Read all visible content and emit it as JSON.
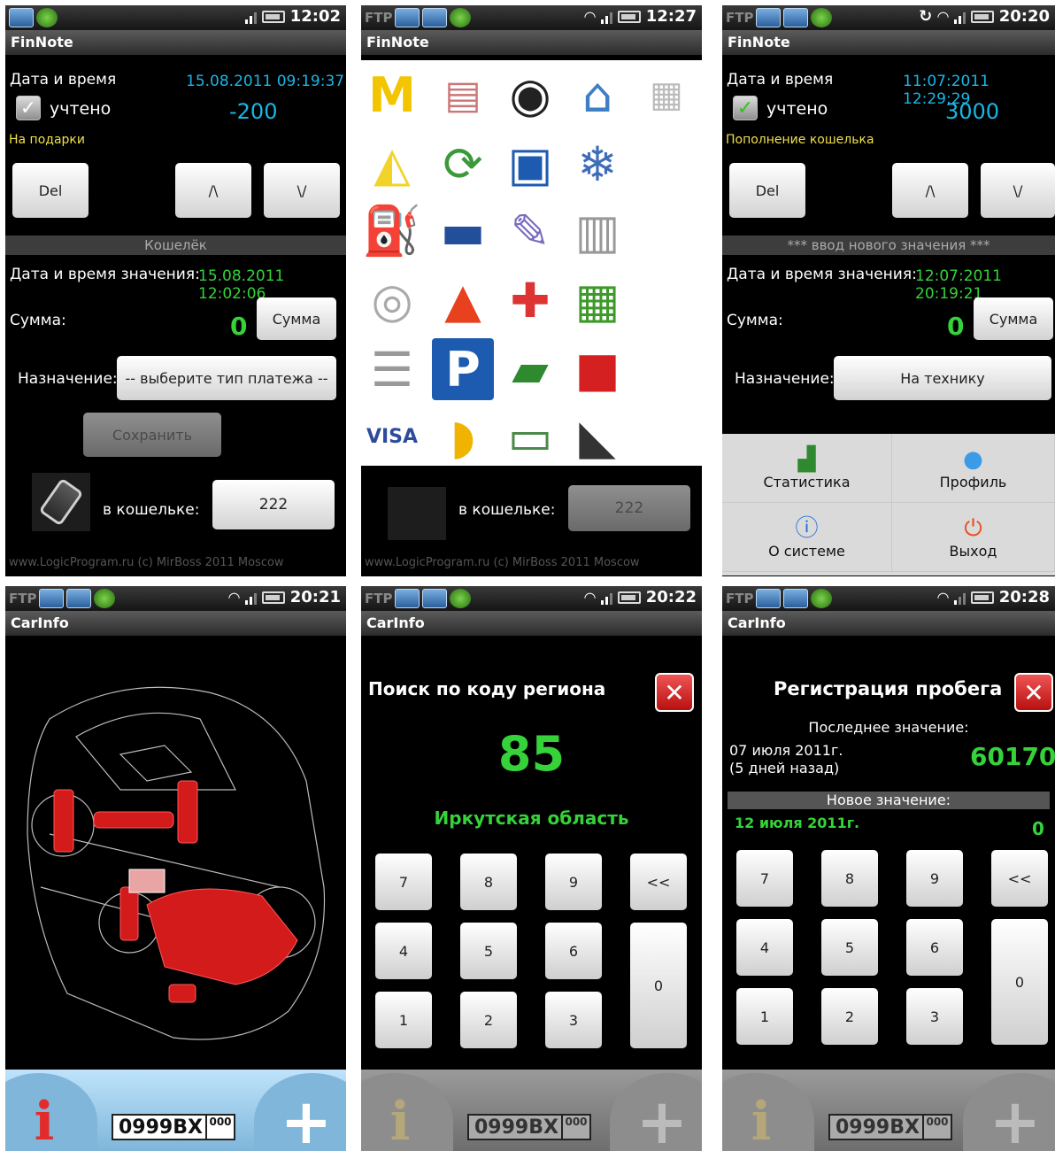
{
  "screens": {
    "s1": {
      "time": "12:02",
      "app_title": "FinNote",
      "datetime_label": "Дата и время",
      "datetime_value": "15.08.2011 09:19:37",
      "accounted_label": "учтено",
      "amount": "-200",
      "note": "На подарки",
      "del_label": "Del",
      "up_label": "/\\",
      "down_label": "\\/",
      "section_title": "Кошелёк",
      "value_datetime_label": "Дата и время значения:",
      "value_datetime": "15.08.2011 12:02:06",
      "sum_label": "Сумма:",
      "sum_value": "0",
      "sum_button": "Сумма",
      "purpose_label": "Назначение:",
      "purpose_value": "-- выберите тип платежа --",
      "save_label": "Сохранить",
      "wallet_label": "в кошельке:",
      "wallet_value": "222",
      "footer": "www.LogicProgram.ru (c) MirBoss 2011 Moscow"
    },
    "s2": {
      "time": "12:27",
      "app_title": "FinNote",
      "wallet_label": "в кошельке:",
      "wallet_value": "222",
      "footer": "www.LogicProgram.ru (c) MirBoss 2011 Moscow",
      "icons": [
        "mcdonalds-icon",
        "receipt-icon",
        "tire-icon",
        "house-icon",
        "document-icon",
        "cheese-icon",
        "refresh-icon",
        "carwash-icon",
        "ice-icon",
        "fuel-nozzle-icon",
        "bus-icon",
        "paint-icon",
        "printer-icon",
        "coins-icon",
        "traffic-cone-icon",
        "medkit-icon",
        "basket-icon",
        "coin-stack-icon",
        "parking-icon",
        "book-icon",
        "gift-icon",
        "visa-card-icon",
        "taxi-icon",
        "banknote-icon",
        "shoe-icon"
      ]
    },
    "s3": {
      "time": "20:20",
      "app_title": "FinNote",
      "datetime_label": "Дата и время",
      "datetime_value": "11:07:2011 12:29:29",
      "accounted_label": "учтено",
      "amount": "3000",
      "note": "Пополнение кошелька",
      "del_label": "Del",
      "up_label": "/\\",
      "down_label": "\\/",
      "section_title": "*** ввод нового значения ***",
      "value_datetime_label": "Дата и время значения:",
      "value_datetime": "12:07:2011 20:19:21",
      "sum_label": "Сумма:",
      "sum_value": "0",
      "sum_button": "Сумма",
      "purpose_label": "Назначение:",
      "purpose_value": "На технику",
      "menu": [
        "Статистика",
        "Профиль",
        "О системе",
        "Выход"
      ]
    },
    "s4": {
      "time": "20:21",
      "app_title": "CarInfo",
      "plate_main": "0999BX",
      "plate_region": "000"
    },
    "s5": {
      "time": "20:22",
      "app_title": "CarInfo",
      "heading": "Поиск по коду региона",
      "code": "85",
      "region": "Иркутская область",
      "keys": [
        "7",
        "8",
        "9",
        "<<",
        "4",
        "5",
        "6",
        "0",
        "1",
        "2",
        "3"
      ],
      "plate_main": "0999BX",
      "plate_region": "000"
    },
    "s6": {
      "time": "20:28",
      "app_title": "CarInfo",
      "heading": "Регистрация пробега",
      "last_label": "Последнее значение:",
      "last_date": "07 июля 2011г.",
      "last_ago": "(5 дней назад)",
      "last_value": "60170",
      "new_label": "Новое значение:",
      "new_date": "12 июля 2011г.",
      "new_value": "0",
      "keys": [
        "7",
        "8",
        "9",
        "<<",
        "4",
        "5",
        "6",
        "0",
        "1",
        "2",
        "3"
      ],
      "plate_main": "0999BX",
      "plate_region": "000"
    }
  },
  "colors": {
    "cyan": "#19b6e6",
    "green": "#35d23a",
    "yellow": "#f0e04a",
    "close_red": "#d42020",
    "bar_blue": "#7fb6da"
  }
}
